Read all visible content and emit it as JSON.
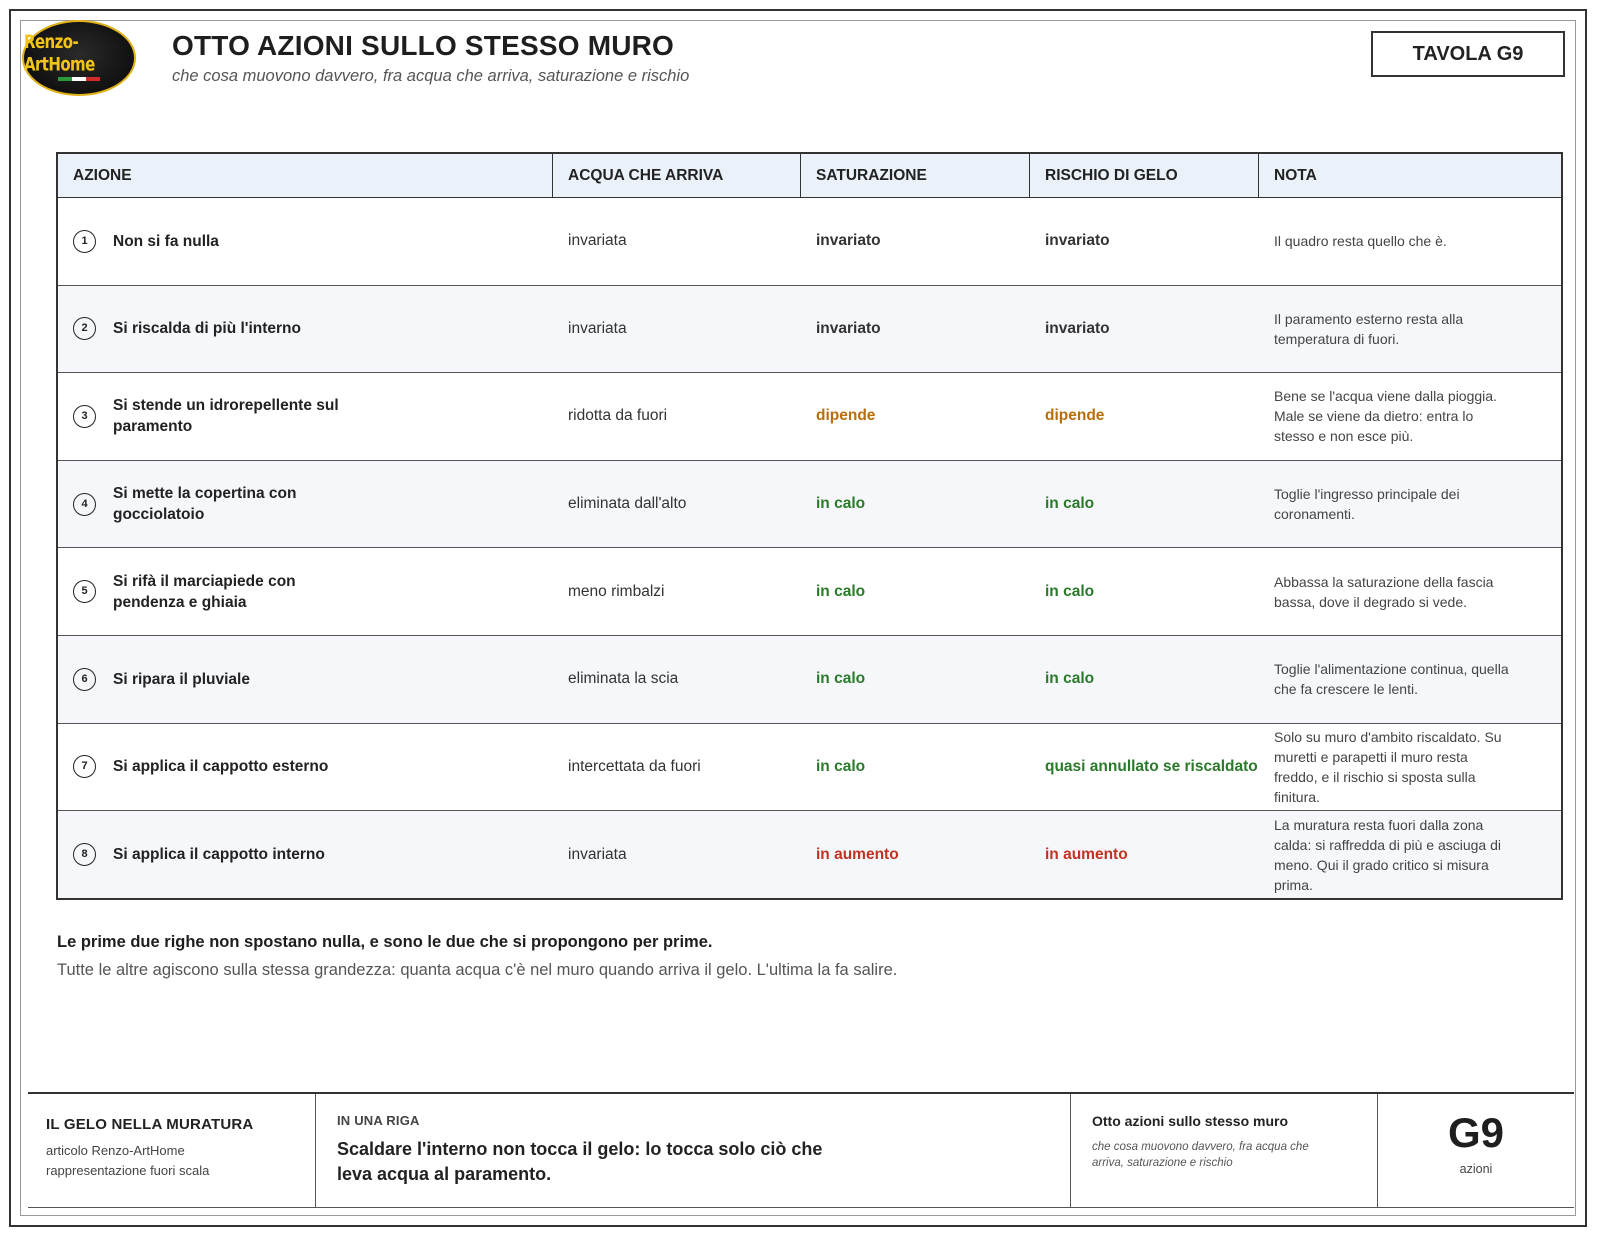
{
  "brand": {
    "logo_text": "Renzo-ArtHome",
    "flag_colors": [
      "#2b9a3c",
      "#ffffff",
      "#d32a2a"
    ]
  },
  "header": {
    "title": "OTTO AZIONI SULLO STESSO MURO",
    "subtitle": "che cosa muovono davvero, fra acqua che arriva, saturazione e rischio",
    "tavola": "TAVOLA G9"
  },
  "table": {
    "columns": [
      "AZIONE",
      "ACQUA CHE ARRIVA",
      "SATURAZIONE",
      "RISCHIO DI GELO",
      "NOTA"
    ],
    "rows": [
      {
        "num": "1",
        "action": "Non si fa nulla",
        "water": "invariata",
        "saturation": "invariato",
        "saturation_status": "neutral",
        "frost": "invariato",
        "frost_status": "neutral",
        "note": "Il quadro resta quello che è."
      },
      {
        "num": "2",
        "action": "Si riscalda di più l'interno",
        "water": "invariata",
        "saturation": "invariato",
        "saturation_status": "neutral",
        "frost": "invariato",
        "frost_status": "neutral",
        "note": "Il paramento esterno resta alla temperatura di fuori."
      },
      {
        "num": "3",
        "action": "Si stende un idrorepellente sul paramento",
        "water": "ridotta da fuori",
        "saturation": "dipende",
        "saturation_status": "depends",
        "frost": "dipende",
        "frost_status": "depends",
        "note": "Bene se l'acqua viene dalla pioggia. Male se viene da dietro: entra lo stesso e non esce più."
      },
      {
        "num": "4",
        "action": "Si mette la copertina con gocciolatoio",
        "water": "eliminata dall'alto",
        "saturation": "in calo",
        "saturation_status": "down",
        "frost": "in calo",
        "frost_status": "down",
        "note": "Toglie l'ingresso principale dei coronamenti."
      },
      {
        "num": "5",
        "action": "Si rifà il marciapiede con pendenza e ghiaia",
        "water": "meno rimbalzi",
        "saturation": "in calo",
        "saturation_status": "down",
        "frost": "in calo",
        "frost_status": "down",
        "note": "Abbassa la saturazione della fascia bassa, dove il degrado si vede."
      },
      {
        "num": "6",
        "action": "Si ripara il pluviale",
        "water": "eliminata la scia",
        "saturation": "in calo",
        "saturation_status": "down",
        "frost": "in calo",
        "frost_status": "down",
        "note": "Toglie l'alimentazione continua, quella che fa crescere le lenti."
      },
      {
        "num": "7",
        "action": "Si applica il cappotto esterno",
        "water": "intercettata da fuori",
        "saturation": "in calo",
        "saturation_status": "down",
        "frost": "quasi annullato se riscaldato",
        "frost_status": "down",
        "note": "Solo su muro d'ambito riscaldato. Su muretti e parapetti il muro resta freddo, e il rischio si sposta sulla finitura."
      },
      {
        "num": "8",
        "action": "Si applica il cappotto interno",
        "water": "invariata",
        "saturation": "in aumento",
        "saturation_status": "up",
        "frost": "in aumento",
        "frost_status": "up",
        "note": "La muratura resta fuori dalla zona calda: si raffredda di più e asciuga di meno. Qui il grado critico si misura prima."
      }
    ]
  },
  "summary": {
    "bold": "Le prime due righe non spostano nulla, e sono le due che si propongono per prime.",
    "text": "Tutte le altre agiscono sulla stessa grandezza: quanta acqua c'è nel muro quando arriva il gelo. L'ultima la fa salire."
  },
  "footer": {
    "series_title": "IL GELO NELLA MURATURA",
    "series_line1": "articolo Renzo-ArtHome",
    "series_line2": "rappresentazione fuori scala",
    "kicker": "IN UNA RIGA",
    "one_line": "Scaldare l'interno non tocca il gelo: lo tocca solo ciò che leva acqua al paramento.",
    "sheet_title": "Otto azioni sullo stesso muro",
    "sheet_subtitle": "che cosa muovono davvero, fra acqua che arriva, saturazione e rischio",
    "code": "G9",
    "code_label": "azioni"
  },
  "status_colors": {
    "neutral": "#333333",
    "depends": "#b86e0a",
    "down": "#2a7a2a",
    "up": "#c03222"
  }
}
